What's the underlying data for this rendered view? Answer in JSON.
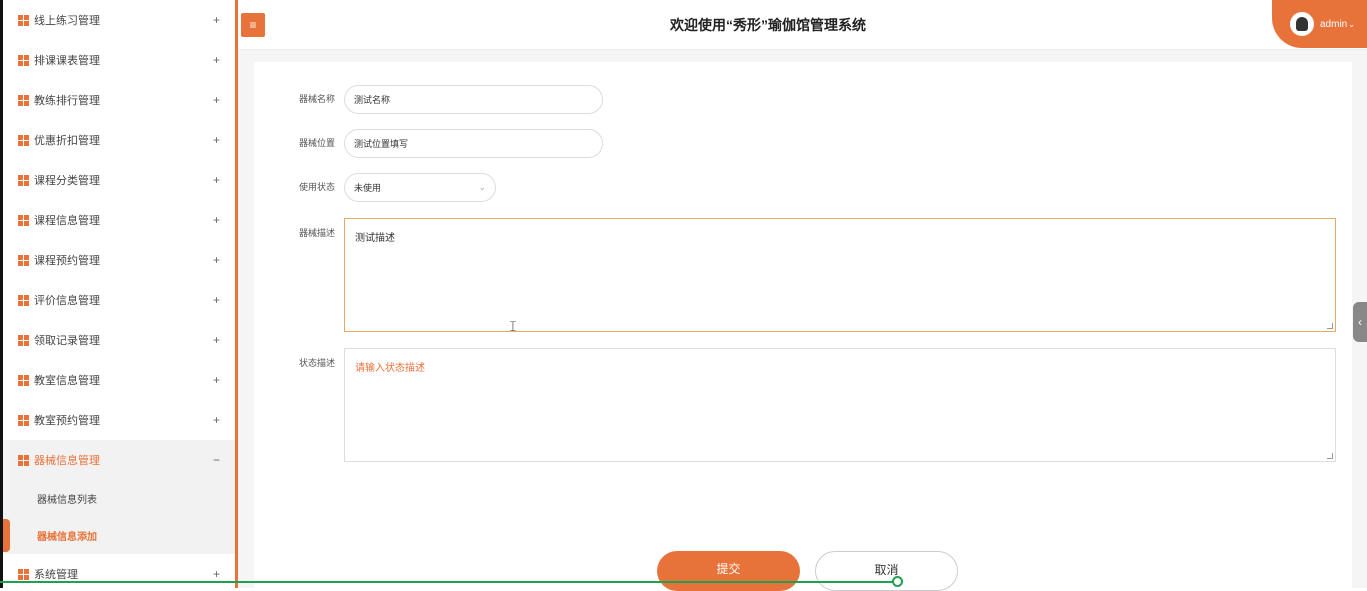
{
  "sidebar": {
    "items": [
      {
        "label": "线上练习管理",
        "expand": "+"
      },
      {
        "label": "排课课表管理",
        "expand": "+"
      },
      {
        "label": "教练排行管理",
        "expand": "+"
      },
      {
        "label": "优惠折扣管理",
        "expand": "+"
      },
      {
        "label": "课程分类管理",
        "expand": "+"
      },
      {
        "label": "课程信息管理",
        "expand": "+"
      },
      {
        "label": "课程预约管理",
        "expand": "+"
      },
      {
        "label": "评价信息管理",
        "expand": "+"
      },
      {
        "label": "领取记录管理",
        "expand": "+"
      },
      {
        "label": "教室信息管理",
        "expand": "+"
      },
      {
        "label": "教室预约管理",
        "expand": "+"
      },
      {
        "label": "器械信息管理",
        "expand": "−"
      },
      {
        "label": "系统管理",
        "expand": "+"
      }
    ],
    "sub_items": [
      {
        "label": "器械信息列表"
      },
      {
        "label": "器械信息添加"
      }
    ]
  },
  "header": {
    "toggle_icon": "≡",
    "title": "欢迎使用“秀形”瑜伽馆管理系统",
    "user": "admin",
    "user_chevron": "⌄"
  },
  "form": {
    "name_label": "器械名称",
    "name_value": "测试名称",
    "location_label": "器械位置",
    "location_value": "测试位置填写",
    "status_label": "使用状态",
    "status_value": "未使用",
    "status_arrow": "⌄",
    "desc_label": "器械描述",
    "desc_value": "测试描述",
    "state_desc_label": "状态描述",
    "state_desc_placeholder": "请输入状态描述",
    "submit_label": "提交",
    "cancel_label": "取消"
  },
  "side_tab_icon": "‹",
  "colors": {
    "accent": "#e8733a"
  }
}
